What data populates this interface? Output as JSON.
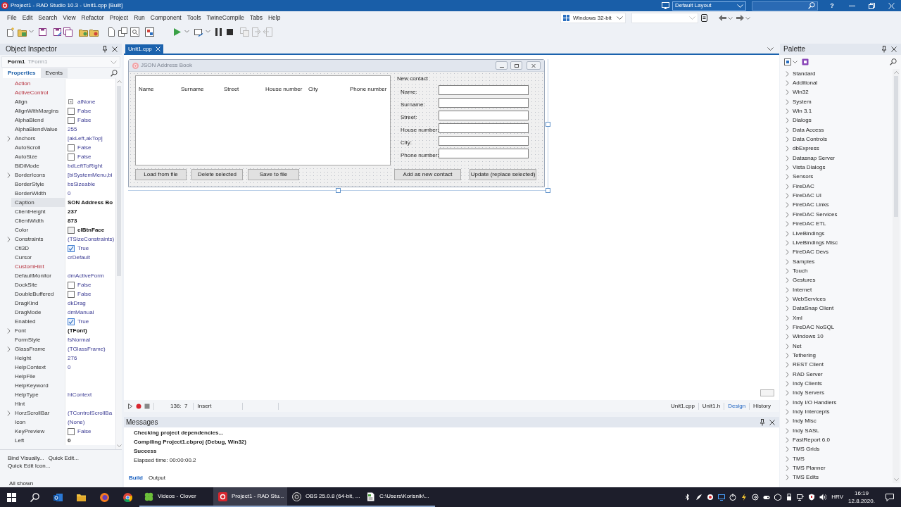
{
  "title_bar": {
    "title": "Project1 - RAD Studio 10.3 - Unit1.cpp [Built]",
    "layout": "Default Layout",
    "help": "?"
  },
  "menu": [
    "File",
    "Edit",
    "Search",
    "View",
    "Refactor",
    "Project",
    "Run",
    "Component",
    "Tools",
    "TwineCompile",
    "Tabs",
    "Help"
  ],
  "toolbar": {
    "platform": "Windows 32-bit"
  },
  "object_inspector": {
    "title": "Object Inspector",
    "component": "Form1",
    "component_class": "TForm1",
    "tabs": [
      {
        "label": "Properties",
        "selected": true
      },
      {
        "label": "Events",
        "selected": false
      }
    ],
    "properties": [
      {
        "name": "Action",
        "kind": "ref",
        "expandable": false,
        "selected": false
      },
      {
        "name": "ActiveControl",
        "kind": "ref",
        "expandable": false,
        "selected": false
      },
      {
        "name": "Align",
        "value": "alNone",
        "kind": "enum_icon",
        "expandable": false,
        "selected": false
      },
      {
        "name": "AlignWithMargins",
        "value": "False",
        "kind": "checkbox",
        "checked": false,
        "expandable": false,
        "selected": false
      },
      {
        "name": "AlphaBlend",
        "value": "False",
        "kind": "checkbox",
        "checked": false,
        "expandable": false,
        "selected": false
      },
      {
        "name": "AlphaBlendValue",
        "value": "255",
        "kind": "text",
        "expandable": false,
        "selected": false
      },
      {
        "name": "Anchors",
        "value": "[akLeft,akTop]",
        "kind": "text",
        "expandable": true,
        "selected": false
      },
      {
        "name": "AutoScroll",
        "value": "False",
        "kind": "checkbox",
        "checked": false,
        "expandable": false,
        "selected": false
      },
      {
        "name": "AutoSize",
        "value": "False",
        "kind": "checkbox",
        "checked": false,
        "expandable": false,
        "selected": false
      },
      {
        "name": "BiDiMode",
        "value": "bdLeftToRight",
        "kind": "text",
        "expandable": false,
        "selected": false
      },
      {
        "name": "BorderIcons",
        "value": "[biSystemMenu,bi",
        "kind": "text",
        "expandable": true,
        "selected": false
      },
      {
        "name": "BorderStyle",
        "value": "bsSizeable",
        "kind": "text",
        "expandable": false,
        "selected": false
      },
      {
        "name": "BorderWidth",
        "value": "0",
        "kind": "text",
        "expandable": false,
        "selected": false
      },
      {
        "name": "Caption",
        "value": "SON Address Bo",
        "kind": "bold",
        "expandable": false,
        "selected": true
      },
      {
        "name": "ClientHeight",
        "value": "237",
        "kind": "bold",
        "expandable": false,
        "selected": false
      },
      {
        "name": "ClientWidth",
        "value": "873",
        "kind": "bold",
        "expandable": false,
        "selected": false
      },
      {
        "name": "Color",
        "value": "clBtnFace",
        "kind": "swatch",
        "expandable": false,
        "selected": false
      },
      {
        "name": "Constraints",
        "value": "(TSizeConstraints)",
        "kind": "text",
        "expandable": true,
        "selected": false
      },
      {
        "name": "Ctl3D",
        "value": "True",
        "kind": "checkbox",
        "checked": true,
        "expandable": false,
        "selected": false
      },
      {
        "name": "Cursor",
        "value": "crDefault",
        "kind": "text",
        "expandable": false,
        "selected": false
      },
      {
        "name": "CustomHint",
        "kind": "ref",
        "expandable": false,
        "selected": false
      },
      {
        "name": "DefaultMonitor",
        "value": "dmActiveForm",
        "kind": "text",
        "expandable": false,
        "selected": false
      },
      {
        "name": "DockSite",
        "value": "False",
        "kind": "checkbox",
        "checked": false,
        "expandable": false,
        "selected": false
      },
      {
        "name": "DoubleBuffered",
        "value": "False",
        "kind": "checkbox",
        "checked": false,
        "expandable": false,
        "selected": false
      },
      {
        "name": "DragKind",
        "value": "dkDrag",
        "kind": "text",
        "expandable": false,
        "selected": false
      },
      {
        "name": "DragMode",
        "value": "dmManual",
        "kind": "text",
        "expandable": false,
        "selected": false
      },
      {
        "name": "Enabled",
        "value": "True",
        "kind": "checkbox",
        "checked": true,
        "expandable": false,
        "selected": false
      },
      {
        "name": "Font",
        "value": "(TFont)",
        "kind": "bold",
        "expandable": true,
        "selected": false
      },
      {
        "name": "FormStyle",
        "value": "fsNormal",
        "kind": "text",
        "expandable": false,
        "selected": false
      },
      {
        "name": "GlassFrame",
        "value": "(TGlassFrame)",
        "kind": "text",
        "expandable": true,
        "selected": false
      },
      {
        "name": "Height",
        "value": "276",
        "kind": "text",
        "expandable": false,
        "selected": false
      },
      {
        "name": "HelpContext",
        "value": "0",
        "kind": "text",
        "expandable": false,
        "selected": false
      },
      {
        "name": "HelpFile",
        "kind": "text",
        "expandable": false,
        "selected": false
      },
      {
        "name": "HelpKeyword",
        "kind": "text",
        "expandable": false,
        "selected": false
      },
      {
        "name": "HelpType",
        "value": "htContext",
        "kind": "text",
        "expandable": false,
        "selected": false
      },
      {
        "name": "Hint",
        "kind": "text",
        "expandable": false,
        "selected": false
      },
      {
        "name": "HorzScrollBar",
        "value": "(TControlScrollBa",
        "kind": "text",
        "expandable": true,
        "selected": false
      },
      {
        "name": "Icon",
        "value": "(None)",
        "kind": "text",
        "expandable": false,
        "selected": false
      },
      {
        "name": "KeyPreview",
        "value": "False",
        "kind": "checkbox",
        "checked": false,
        "expandable": false,
        "selected": false
      },
      {
        "name": "Left",
        "value": "0",
        "kind": "bold",
        "expandable": false,
        "selected": false
      }
    ],
    "links": [
      "Bind Visually...",
      "Quick Edit...",
      "Quick Edit Icon..."
    ],
    "status": "All shown"
  },
  "editor": {
    "tabs": [
      {
        "label": "Unit1.cpp",
        "selected": true
      }
    ],
    "form": {
      "caption": "JSON Address Book",
      "columns": [
        "Name",
        "Surname",
        "Street",
        "House number",
        "City",
        "Phone number"
      ],
      "group_title": "New contact",
      "field_labels": [
        "Name:",
        "Surname:",
        "Street:",
        "House number:",
        "City:",
        "Phone number:"
      ],
      "list_buttons": [
        "Load from file",
        "Delete selected",
        "Save to file"
      ],
      "contact_buttons": [
        "Add as new contact",
        "Update (replace selected)"
      ]
    },
    "status_bar": {
      "position": "136:  7",
      "mode": "Insert",
      "views": [
        {
          "label": "Unit1.cpp",
          "selected": false
        },
        {
          "label": "Unit1.h",
          "selected": false
        },
        {
          "label": "Design",
          "selected": true
        },
        {
          "label": "History",
          "selected": false
        }
      ]
    }
  },
  "messages": {
    "title": "Messages",
    "lines": [
      {
        "text": "Checking project dependencies...",
        "bold": true
      },
      {
        "text": "Compiling Project1.cbproj (Debug, Win32)",
        "bold": true
      },
      {
        "text": "Success",
        "bold": true
      },
      {
        "text": "Elapsed time: 00:00:00.2",
        "bold": false
      }
    ],
    "tabs": [
      {
        "label": "Build",
        "selected": true
      },
      {
        "label": "Output",
        "selected": false
      }
    ]
  },
  "palette": {
    "title": "Palette",
    "items": [
      {
        "label": "Standard",
        "expanded": false
      },
      {
        "label": "Additional",
        "expanded": false
      },
      {
        "label": "Win32",
        "expanded": false
      },
      {
        "label": "System",
        "expanded": false
      },
      {
        "label": "Win 3.1",
        "expanded": false
      },
      {
        "label": "Dialogs",
        "expanded": false
      },
      {
        "label": "Data Access",
        "expanded": false
      },
      {
        "label": "Data Controls",
        "expanded": false
      },
      {
        "label": "dbExpress",
        "expanded": false
      },
      {
        "label": "Datasnap Server",
        "expanded": false
      },
      {
        "label": "Vista Dialogs",
        "expanded": false
      },
      {
        "label": "Sensors",
        "expanded": false
      },
      {
        "label": "FireDAC",
        "expanded": false
      },
      {
        "label": "FireDAC UI",
        "expanded": false
      },
      {
        "label": "FireDAC Links",
        "expanded": false
      },
      {
        "label": "FireDAC Services",
        "expanded": false
      },
      {
        "label": "FireDAC ETL",
        "expanded": false
      },
      {
        "label": "LiveBindings",
        "expanded": false
      },
      {
        "label": "LiveBindings Misc",
        "expanded": false
      },
      {
        "label": "FireDAC Devs",
        "expanded": false
      },
      {
        "label": "Samples",
        "expanded": false
      },
      {
        "label": "Touch",
        "expanded": false
      },
      {
        "label": "Gestures",
        "expanded": false
      },
      {
        "label": "Internet",
        "expanded": false
      },
      {
        "label": "WebServices",
        "expanded": false
      },
      {
        "label": "DataSnap Client",
        "expanded": false
      },
      {
        "label": "Xml",
        "expanded": false
      },
      {
        "label": "FireDAC NoSQL",
        "expanded": false
      },
      {
        "label": "Windows 10",
        "expanded": false
      },
      {
        "label": "Net",
        "expanded": false
      },
      {
        "label": "Tethering",
        "expanded": false
      },
      {
        "label": "REST Client",
        "expanded": false
      },
      {
        "label": "RAD Server",
        "expanded": false
      },
      {
        "label": "Indy Clients",
        "expanded": false
      },
      {
        "label": "Indy Servers",
        "expanded": false
      },
      {
        "label": "Indy I/O Handlers",
        "expanded": false
      },
      {
        "label": "Indy Intercepts",
        "expanded": false
      },
      {
        "label": "Indy Misc",
        "expanded": false
      },
      {
        "label": "Indy SASL",
        "expanded": false
      },
      {
        "label": "FastReport 6.0",
        "expanded": false
      },
      {
        "label": "TMS Grids",
        "expanded": false
      },
      {
        "label": "TMS",
        "expanded": false
      },
      {
        "label": "TMS Planner",
        "expanded": false
      },
      {
        "label": "TMS Edits",
        "expanded": false
      }
    ]
  },
  "taskbar": {
    "apps": [
      {
        "label": "Videos - Clover",
        "selected": false
      },
      {
        "label": "Project1 - RAD Stu...",
        "selected": true
      },
      {
        "label": "OBS 25.0.8 (64-bit, ...",
        "selected": false
      },
      {
        "label": "C:\\Users\\Korisnik\\...",
        "selected": false
      }
    ],
    "language": "HRV",
    "time": "16:19",
    "date": "12.8.2020."
  }
}
